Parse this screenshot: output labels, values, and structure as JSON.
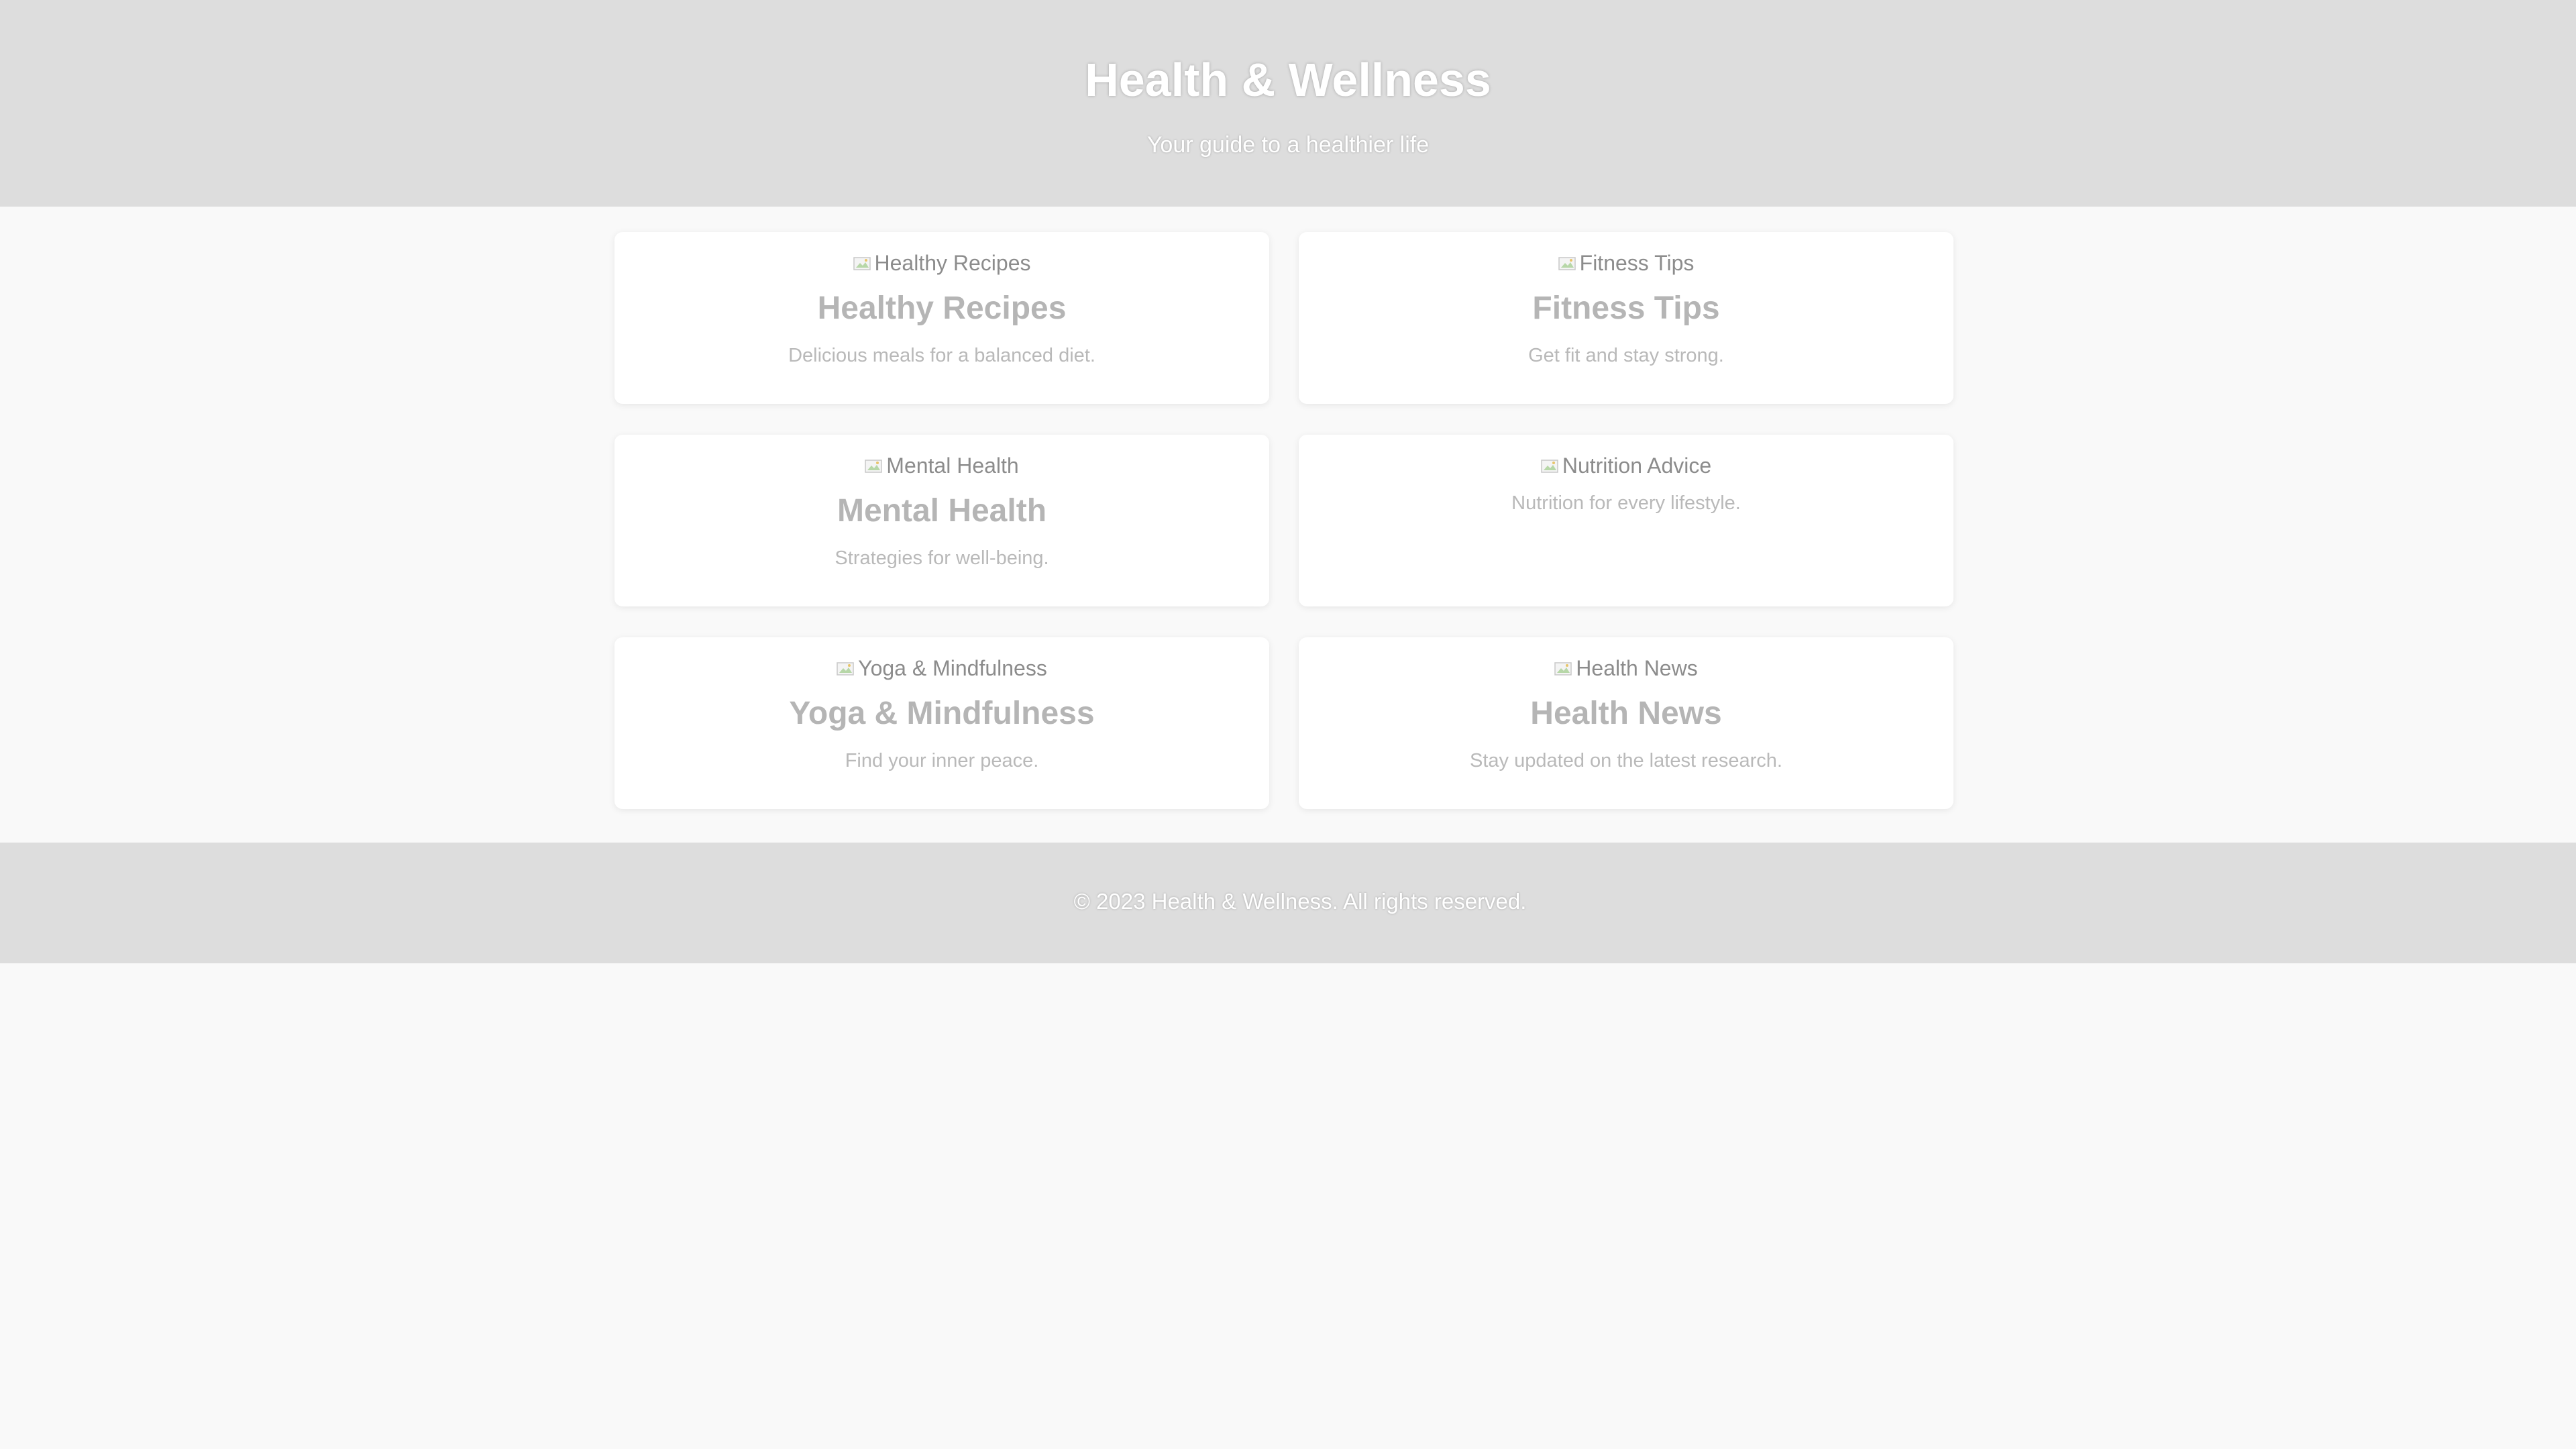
{
  "header": {
    "title": "Health & Wellness",
    "subtitle": "Your guide to a healthier life"
  },
  "cards": [
    {
      "image_alt": "Healthy Recipes",
      "title": "Healthy Recipes",
      "description": "Delicious meals for a balanced diet."
    },
    {
      "image_alt": "Fitness Tips",
      "title": "Fitness Tips",
      "description": "Get fit and stay strong."
    },
    {
      "image_alt": "Mental Health",
      "title": "Mental Health",
      "description": "Strategies for well-being."
    },
    {
      "image_alt": "Nutrition Advice",
      "title": "",
      "description": "Nutrition for every lifestyle."
    },
    {
      "image_alt": "Yoga & Mindfulness",
      "title": "Yoga & Mindfulness",
      "description": "Find your inner peace."
    },
    {
      "image_alt": "Health News",
      "title": "Health News",
      "description": "Stay updated on the latest research."
    }
  ],
  "footer": {
    "copyright": "© 2023 Health & Wellness. All rights reserved."
  },
  "colors": {
    "header_bg": "#dddddd",
    "page_bg": "#f9f9f9",
    "card_bg": "#ffffff",
    "card_title": "#b5b5b5",
    "card_text": "#b9b9b9"
  },
  "icons": {
    "card_image": "broken-image-icon"
  }
}
